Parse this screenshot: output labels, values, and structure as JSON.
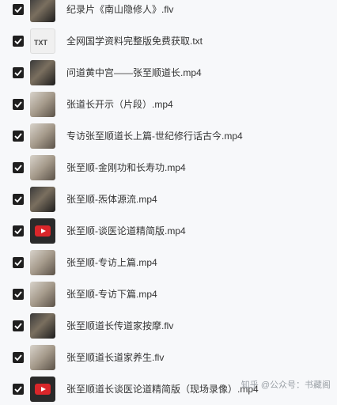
{
  "files": [
    {
      "name": "纪录片《南山隐修人》.flv",
      "checked": true,
      "thumb": "video-dark"
    },
    {
      "name": "全网国学资料完整版免费获取.txt",
      "checked": true,
      "thumb": "txt",
      "thumb_label": "TXT"
    },
    {
      "name": "问道黄中宫——张至顺道长.mp4",
      "checked": true,
      "thumb": "video-dark"
    },
    {
      "name": "张道长开示（片段）.mp4",
      "checked": true,
      "thumb": "video-bright"
    },
    {
      "name": "专访张至顺道长上篇-世纪修行话古今.mp4",
      "checked": true,
      "thumb": "video-bright"
    },
    {
      "name": "张至顺-金刚功和长寿功.mp4",
      "checked": true,
      "thumb": "video-bright"
    },
    {
      "name": "张至顺-炁体源流.mp4",
      "checked": true,
      "thumb": "video-dark"
    },
    {
      "name": "张至顺-谈医论道精简版.mp4",
      "checked": true,
      "thumb": "video-red"
    },
    {
      "name": "张至顺-专访上篇.mp4",
      "checked": true,
      "thumb": "video-bright"
    },
    {
      "name": "张至顺-专访下篇.mp4",
      "checked": true,
      "thumb": "video-bright"
    },
    {
      "name": "张至顺道长传道家按摩.flv",
      "checked": true,
      "thumb": "video-dark"
    },
    {
      "name": "张至顺道长道家养生.flv",
      "checked": true,
      "thumb": "video-bright"
    },
    {
      "name": "张至顺道长谈医论道精简版（现场录像）.mp4",
      "checked": true,
      "thumb": "video-red"
    }
  ],
  "watermark": "知乎 @公众号：书藏阁"
}
